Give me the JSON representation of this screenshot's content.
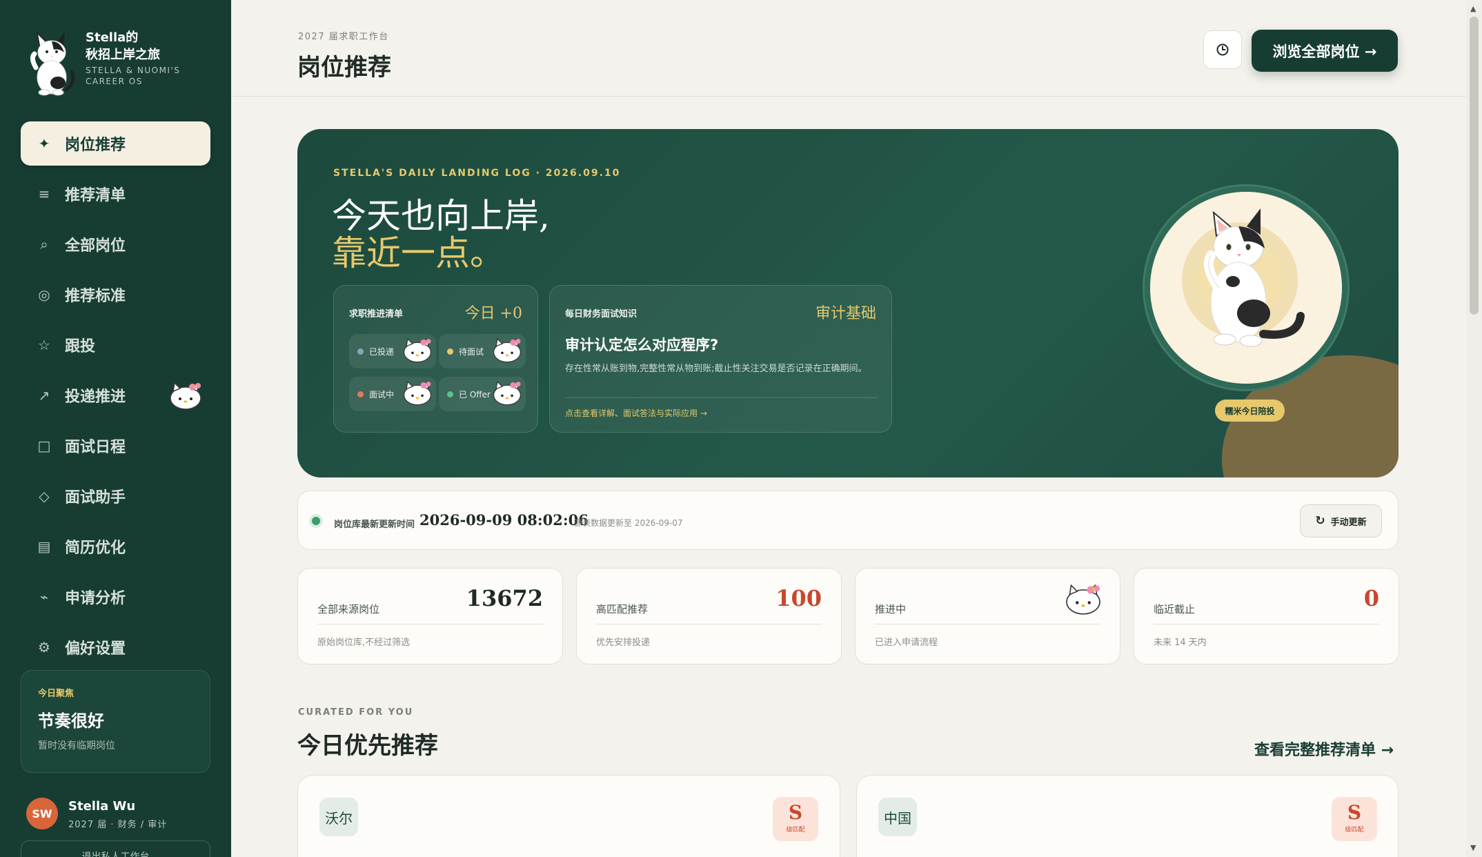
{
  "sidebar": {
    "brand_title_line1": "Stella的",
    "brand_title_line2": "秋招上岸之旅",
    "brand_sub_line1": "STELLA & NUOMI'S",
    "brand_sub_line2": "CAREER OS",
    "nav": [
      {
        "label": "岗位推荐",
        "icon": "sparkle-icon",
        "active": true
      },
      {
        "label": "推荐清单",
        "icon": "list-icon"
      },
      {
        "label": "全部岗位",
        "icon": "search-icon"
      },
      {
        "label": "推荐标准",
        "icon": "target-icon"
      },
      {
        "label": "跟投",
        "icon": "star-icon"
      },
      {
        "label": "投递推进",
        "icon": "arrow-up-right-icon"
      },
      {
        "label": "面试日程",
        "icon": "square-icon"
      },
      {
        "label": "面试助手",
        "icon": "diamond-icon"
      },
      {
        "label": "简历优化",
        "icon": "document-icon"
      },
      {
        "label": "申请分析",
        "icon": "trend-icon"
      },
      {
        "label": "偏好设置",
        "icon": "gear-icon"
      }
    ],
    "focus": {
      "kicker": "今日聚焦",
      "title": "节奏很好",
      "sub": "暂时没有临期岗位"
    },
    "user": {
      "initials": "SW",
      "name": "Stella Wu",
      "meta": "2027 届 · 财务 / 审计"
    },
    "logout_label": "退出私人工作台"
  },
  "header": {
    "kicker": "2027 届求职工作台",
    "title": "岗位推荐",
    "history_icon": "clock-icon",
    "browse_label": "浏览全部岗位  →"
  },
  "hero": {
    "kicker": "STELLA'S DAILY LANDING LOG · 2026.09.10",
    "line1": "今天也向上岸,",
    "line2": "靠近一点。",
    "pipeline": {
      "title": "求职推进清单",
      "today": "今日 +0",
      "pills": [
        {
          "label": "已投递",
          "color": "#8ea3b8"
        },
        {
          "label": "待面试",
          "color": "#e7c86c"
        },
        {
          "label": "面试中",
          "color": "#e07a5f"
        },
        {
          "label": "已 Offer",
          "color": "#5fbf8a"
        }
      ]
    },
    "quiz": {
      "kicker": "每日财务面试知识",
      "tag": "审计基础",
      "question": "审计认定怎么对应程序?",
      "answer": "存在性常从账到物,完整性常从物到账;截止性关注交易是否记录在正确期间。",
      "link": "点击查看详解、面试答法与实际应用 →"
    },
    "cat_badge": "糯米今日陪投"
  },
  "update": {
    "label": "岗位库最新更新时间",
    "time": "2026-09-09 08:02:06",
    "source": "源表数据更新至 2026-09-07",
    "refresh_label": "手动更新"
  },
  "stats": [
    {
      "label": "全部来源岗位",
      "value": "13672",
      "sub": "原始岗位库,不经过筛选"
    },
    {
      "label": "高匹配推荐",
      "value": "100",
      "sub": "优先安排投递"
    },
    {
      "label": "推进中",
      "value": "",
      "sub": "已进入申请流程"
    },
    {
      "label": "临近截止",
      "value": "0",
      "sub": "未来 14 天内"
    }
  ],
  "curated": {
    "kicker": "CURATED FOR YOU",
    "title": "今日优先推荐",
    "link": "查看完整推荐清单 →",
    "jobs": [
      {
        "company": "沃尔",
        "grade": "S",
        "grade_sub": "级匹配"
      },
      {
        "company": "中国",
        "grade": "S",
        "grade_sub": "级匹配"
      }
    ]
  },
  "colors": {
    "sidebar": "#173d33",
    "accent_gold": "#e7c86c",
    "accent_red": "#c8472d",
    "background": "#f4f2ec"
  }
}
